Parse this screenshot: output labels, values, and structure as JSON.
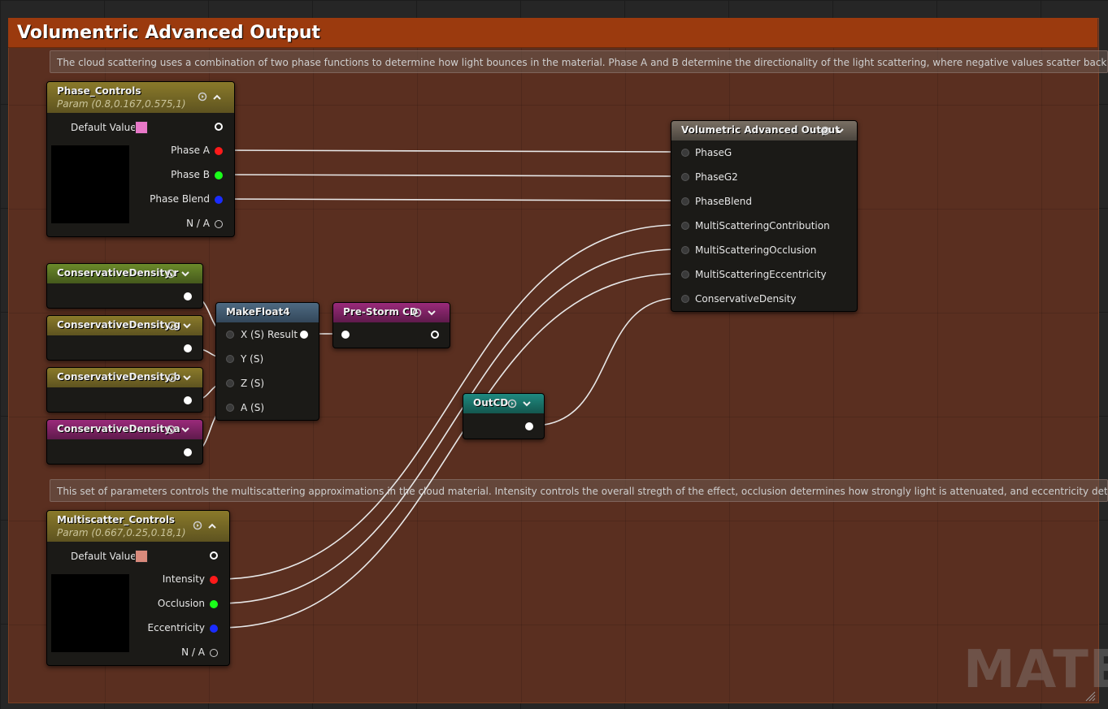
{
  "comment": {
    "title": "Volumentric Advanced Output",
    "note_top": "The cloud scattering uses a combination of two phase functions to determine how light bounces in the material.  Phase A and B determine the directionality of the light scattering, where negative values scatter backward toward th",
    "note_mid": "This set of parameters controls the multiscattering approximations in the cloud material.  Intensity controls the overall stregth of the effect, occlusion determines how strongly light is attenuated, and eccentricity determines how",
    "watermark": "MATER"
  },
  "phase_controls": {
    "title": "Phase_Controls",
    "subtitle": "Param (0.8,0.167,0.575,1)",
    "default_label": "Default Value",
    "swatch_color": "#e878c8",
    "outputs": [
      "Phase A",
      "Phase B",
      "Phase Blend",
      "N / A"
    ]
  },
  "multiscatter_controls": {
    "title": "Multiscatter_Controls",
    "subtitle": "Param (0.667,0.25,0.18,1)",
    "default_label": "Default Value",
    "swatch_color": "#d98a7c",
    "outputs": [
      "Intensity",
      "Occlusion",
      "Eccentricity",
      "N / A"
    ]
  },
  "cd_nodes": [
    {
      "title": "ConservativeDensity.r"
    },
    {
      "title": "ConservativeDensity.g"
    },
    {
      "title": "ConservativeDensity.b"
    },
    {
      "title": "ConservativeDensity.a"
    }
  ],
  "make_float4": {
    "title": "MakeFloat4",
    "inputs": [
      "X (S)",
      "Y (S)",
      "Z (S)",
      "A (S)"
    ],
    "output": "Result"
  },
  "prestorm": {
    "title": "Pre-Storm CD"
  },
  "outcd": {
    "title": "OutCD"
  },
  "volumetric_output": {
    "title": "Volumetric Advanced Output",
    "inputs": [
      "PhaseG",
      "PhaseG2",
      "PhaseBlend",
      "MultiScatteringContribution",
      "MultiScatteringOcclusion",
      "MultiScatteringEccentricity",
      "ConservativeDensity"
    ]
  },
  "colors": {
    "pin_red": "#ff1a1a",
    "pin_green": "#1aff1a",
    "pin_blue": "#1a2cff",
    "pin_white": "#ffffff",
    "wire": "#e8e8e8"
  }
}
